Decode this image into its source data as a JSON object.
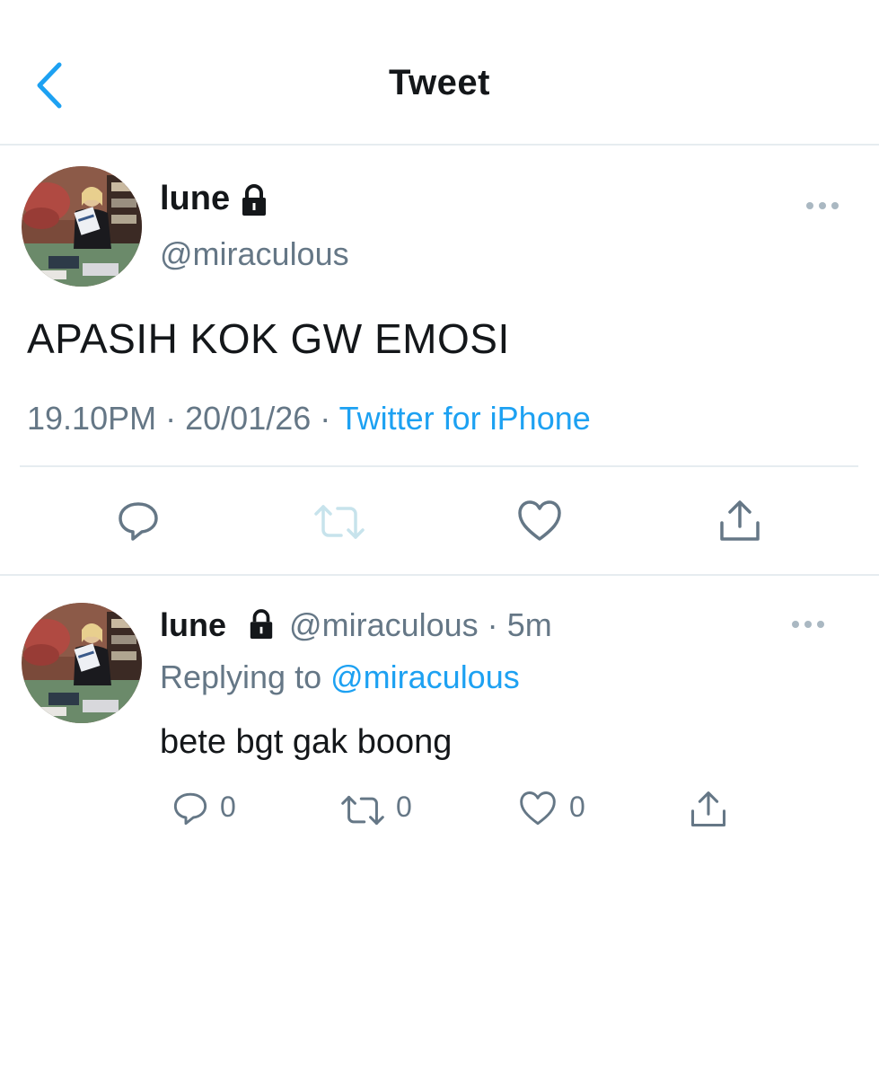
{
  "header": {
    "title": "Tweet"
  },
  "main_tweet": {
    "display_name": "lune",
    "handle": "@miraculous",
    "text": "APASIH KOK GW EMOSI",
    "time": "19.10PM",
    "date": "20/01/26",
    "separator": "·",
    "source": "Twitter for iPhone"
  },
  "reply_tweet": {
    "display_name": "lune",
    "handle": "@miraculous",
    "separator": "·",
    "age": "5m",
    "replying_prefix": "Replying to",
    "replying_to": "@miraculous",
    "text": "bete bgt gak boong",
    "reply_count": "0",
    "retweet_count": "0",
    "like_count": "0"
  },
  "colors": {
    "accent": "#1da1f2",
    "text_primary": "#14171a",
    "text_secondary": "#657786",
    "divider": "#e6ecf0",
    "disabled_icon": "#c7e3ec"
  }
}
